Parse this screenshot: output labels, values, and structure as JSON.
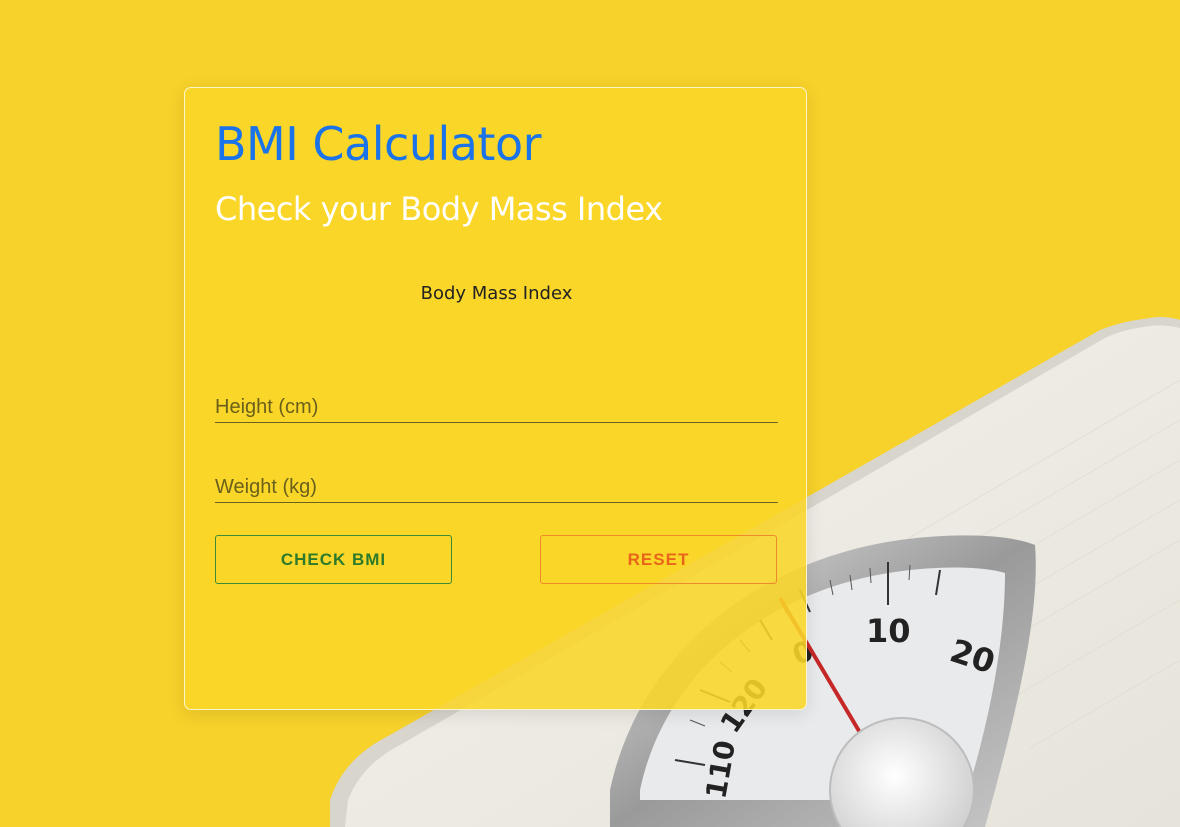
{
  "card": {
    "title": "BMI Calculator",
    "subtitle": "Check your Body Mass Index",
    "result_label": "Body Mass Index"
  },
  "form": {
    "height_placeholder": "Height (cm)",
    "height_value": "",
    "weight_placeholder": "Weight (kg)",
    "weight_value": ""
  },
  "buttons": {
    "check_label": "CHECK BMI",
    "reset_label": "RESET"
  },
  "background": {
    "scale_dial_labels": [
      "10",
      "20",
      "0",
      "120",
      "110"
    ]
  },
  "colors": {
    "background": "#f7d22b",
    "title": "#1a73e8",
    "subtitle": "#ffffff",
    "check_button": "#2f7a2a",
    "reset_button": "#e8651a"
  }
}
